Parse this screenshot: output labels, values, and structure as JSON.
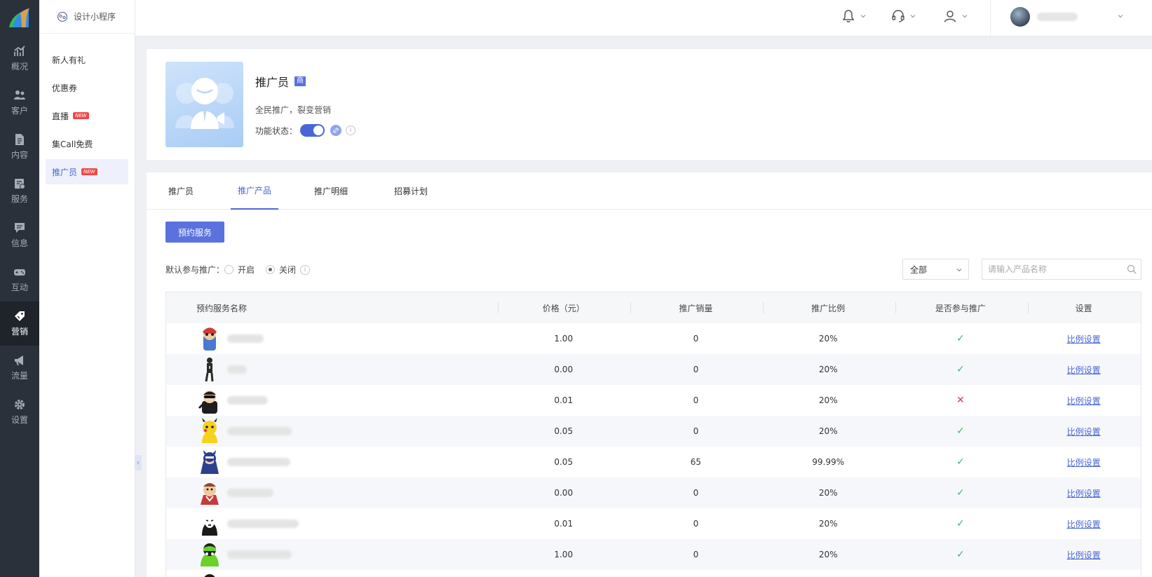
{
  "brand": {
    "accent": "#4a66d6",
    "rail_bg": "#2b313a"
  },
  "rail": {
    "items": [
      {
        "label": "概况",
        "icon": "chart-icon"
      },
      {
        "label": "客户",
        "icon": "users-icon"
      },
      {
        "label": "内容",
        "icon": "document-icon"
      },
      {
        "label": "服务",
        "icon": "service-icon"
      },
      {
        "label": "信息",
        "icon": "message-icon"
      },
      {
        "label": "互动",
        "icon": "gamepad-icon"
      },
      {
        "label": "营销",
        "icon": "tag-icon"
      },
      {
        "label": "流量",
        "icon": "megaphone-icon"
      },
      {
        "label": "设置",
        "icon": "gear-icon"
      }
    ]
  },
  "subside": {
    "app_title": "设计小程序",
    "items": [
      {
        "label": "新人有礼"
      },
      {
        "label": "优惠券"
      },
      {
        "label": "直播",
        "badge": "NEW"
      },
      {
        "label": "集Call免费"
      },
      {
        "label": "推广员",
        "badge": "NEW"
      }
    ]
  },
  "feature": {
    "title": "推广员",
    "tag": "商",
    "description": "全民推广，裂变营销",
    "status_label": "功能状态：",
    "enabled": true
  },
  "tabs": [
    "推广员",
    "推广产品",
    "推广明细",
    "招募计划"
  ],
  "toolbar": {
    "primary_button": "预约服务",
    "default_label": "默认参与推广：",
    "opt_on": "开启",
    "opt_off": "关闭",
    "selected": "关闭",
    "filter_value": "全部",
    "search_placeholder": "请输入产品名称"
  },
  "table": {
    "columns": [
      "预约服务名称",
      "价格（元）",
      "推广销量",
      "推广比例",
      "是否参与推广",
      "设置"
    ],
    "rows": [
      {
        "price": "1.00",
        "sales": "0",
        "ratio": "20%",
        "participating": true,
        "action": "比例设置"
      },
      {
        "price": "0.00",
        "sales": "0",
        "ratio": "20%",
        "participating": true,
        "action": "比例设置"
      },
      {
        "price": "0.01",
        "sales": "0",
        "ratio": "20%",
        "participating": false,
        "action": "比例设置"
      },
      {
        "price": "0.05",
        "sales": "0",
        "ratio": "20%",
        "participating": true,
        "action": "比例设置"
      },
      {
        "price": "0.05",
        "sales": "65",
        "ratio": "99.99%",
        "participating": true,
        "action": "比例设置"
      },
      {
        "price": "0.00",
        "sales": "0",
        "ratio": "20%",
        "participating": true,
        "action": "比例设置"
      },
      {
        "price": "0.01",
        "sales": "0",
        "ratio": "20%",
        "participating": true,
        "action": "比例设置"
      },
      {
        "price": "1.00",
        "sales": "0",
        "ratio": "20%",
        "participating": true,
        "action": "比例设置"
      }
    ]
  }
}
